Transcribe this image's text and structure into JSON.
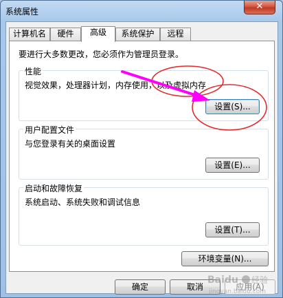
{
  "window": {
    "title": "系统属性",
    "close_label": "✕"
  },
  "tabs": [
    {
      "label": "计算机名"
    },
    {
      "label": "硬件"
    },
    {
      "label": "高级"
    },
    {
      "label": "系统保护"
    },
    {
      "label": "远程"
    }
  ],
  "panel": {
    "admin_note": "要进行大多数更改，您必须作为管理员登录。",
    "performance": {
      "title": "性能",
      "description": "视觉效果，处理器计划，内存使用，以及虚拟内存",
      "settings_label": "设置(S)..."
    },
    "user_profiles": {
      "title": "用户配置文件",
      "description": "与您登录有关的桌面设置",
      "settings_label": "设置(E)..."
    },
    "startup_recovery": {
      "title": "启动和故障恢复",
      "description": "系统启动、系统失败和调试信息",
      "settings_label": "设置(T)..."
    },
    "env_vars_label": "环境变量(N)..."
  },
  "footer": {
    "ok_label": "确定",
    "cancel_label": "取消",
    "apply_label": "应用(A)"
  },
  "annotation_color": "#ff00ff",
  "circle_color": "#e8282d"
}
